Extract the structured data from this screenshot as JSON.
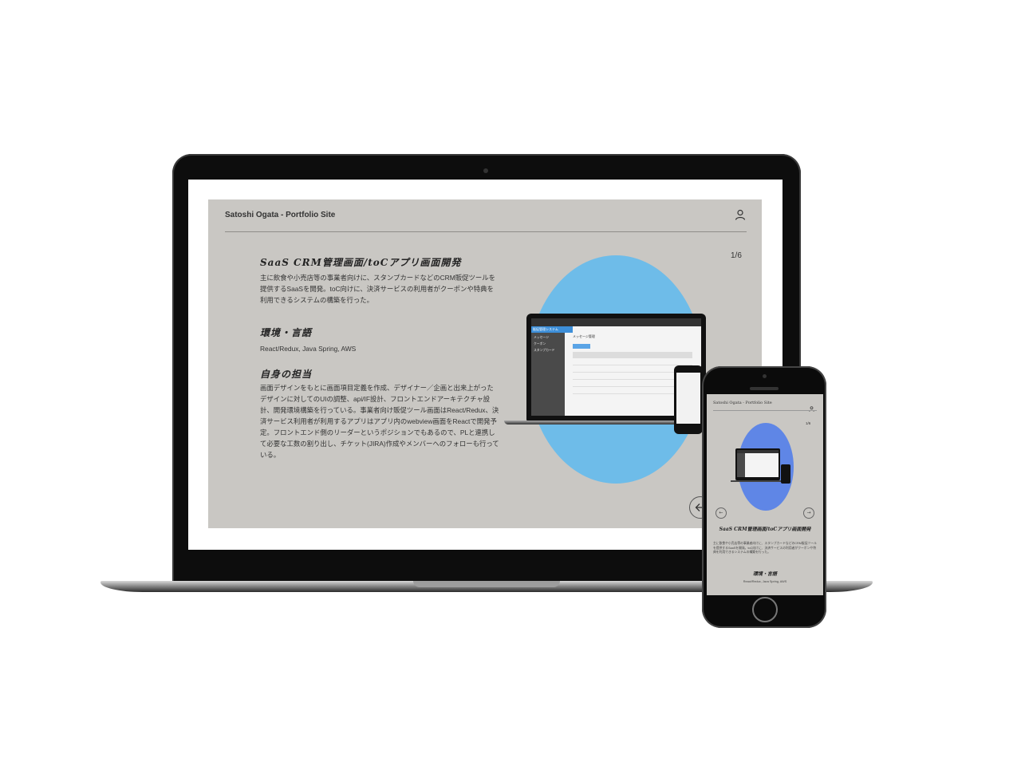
{
  "site": {
    "title": "Satoshi Ogata - Portfolio Site",
    "counter": "1/6",
    "project_title": "SaaS CRM管理画面/toCアプリ画面開発",
    "project_desc": "主に飲食や小売店等の事業者向けに、スタンプカードなどのCRM販促ツールを提供するSaaSを開発。toC向けに、決済サービスの利用者がクーポンや特典を利用できるシステムの構築を行った。",
    "env_heading": "環境・言語",
    "env_text": "React/Redux, Java Spring, AWS",
    "role_heading": "自身の担当",
    "role_text": "画面デザインをもとに画面項目定義を作成、デザイナー／企画と出来上がったデザインに対してのUIの調整、api/IF設計、フロントエンドアーキテクチャ設計、開発環境構築を行っている。事業者向け販促ツール画面はReact/Redux、決済サービス利用者が利用するアプリはアプリ内のwebview画面をReactで開発予定。フロントエンド側のリーダーというポジションでもあるので、PLと連携して必要な工数の割り出し、チケット(JIRA)作成やメンバーへのフォローも行っている。",
    "user_icon": "user-icon",
    "prev_icon": "arrow-left-icon",
    "next_icon": "arrow-right-icon"
  },
  "mini_app": {
    "sidebar_title": "販促管理システム",
    "sidebar_items": [
      "メッセージ",
      "クーポン",
      "スタンプカード"
    ],
    "page_title": "メッセージ管理",
    "add_button": "新規作成"
  },
  "colors": {
    "site_bg": "#c9c7c3",
    "circle_laptop": "#6ebce9",
    "circle_phone": "#5f86e6",
    "device_body": "#0d0d0d"
  }
}
